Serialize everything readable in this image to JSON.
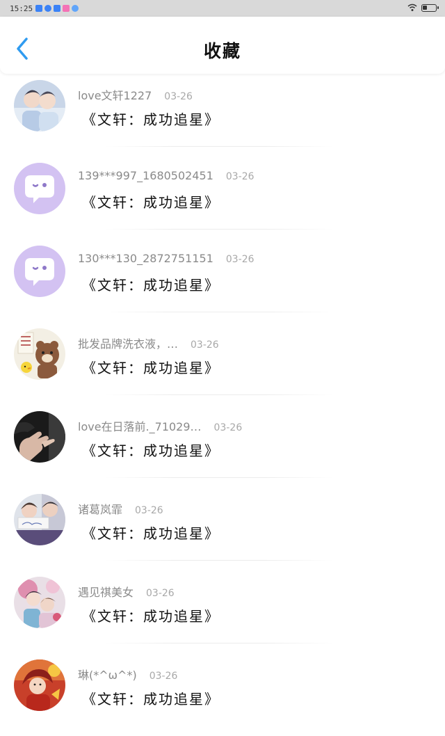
{
  "status_bar": {
    "time": "15:25",
    "app_icon_colors": [
      "#3b82f6",
      "#3b82f6",
      "#3b82f6",
      "#f472b6",
      "#60a5fa"
    ]
  },
  "header": {
    "title": "收藏",
    "back_icon": "chevron-left-icon",
    "accent_color": "#2f9bf0"
  },
  "items": [
    {
      "username": "love文轩1227",
      "date": "03-26",
      "title": "《文轩：成功追星》",
      "avatar": "photo-two-boys"
    },
    {
      "username": "139***997_1680502451",
      "date": "03-26",
      "title": "《文轩：成功追星》",
      "avatar": "default-chat-bubble"
    },
    {
      "username": "130***130_2872751151",
      "date": "03-26",
      "title": "《文轩：成功追星》",
      "avatar": "default-chat-bubble"
    },
    {
      "username": "批发品牌洗衣液，…",
      "date": "03-26",
      "title": "《文轩：成功追星》",
      "avatar": "cartoon-bear"
    },
    {
      "username": "love在日落前._71029…",
      "date": "03-26",
      "title": "《文轩：成功追星》",
      "avatar": "photo-hand"
    },
    {
      "username": "诸葛岚霏",
      "date": "03-26",
      "title": "《文轩：成功追星》",
      "avatar": "photo-couple"
    },
    {
      "username": "遇见祺美女",
      "date": "03-26",
      "title": "《文轩：成功追星》",
      "avatar": "photo-illustration"
    },
    {
      "username": "琳(*^ω^*)",
      "date": "03-26",
      "title": "《文轩：成功追星》",
      "avatar": "photo-girl-red"
    }
  ]
}
